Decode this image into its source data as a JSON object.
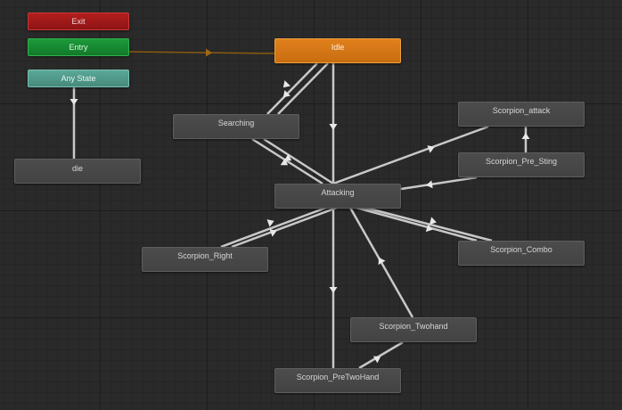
{
  "states": {
    "exit": "Exit",
    "entry": "Entry",
    "any_state": "Any State",
    "die": "die",
    "idle": "Idle",
    "searching": "Searching",
    "attacking": "Attacking",
    "scorpion_attack": "Scorpion_attack",
    "scorpion_pre_sting": "Scorpion_Pre_Sting",
    "scorpion_right": "Scorpion_Right",
    "scorpion_combo": "Scorpion_Combo",
    "scorpion_twohand": "Scorpion_Twohand",
    "scorpion_pretwohand": "Scorpion_PreTwoHand"
  },
  "colors": {
    "background": "#2a2a2a",
    "exit": "#9e1a1a",
    "entry": "#178a32",
    "any_state": "#4f9a8a",
    "default_state": "#d87a16",
    "state": "#484848",
    "transition": "#c8c8c8",
    "entry_transition": "#8a5a10"
  },
  "transitions": [
    {
      "from": "Entry",
      "to": "Idle",
      "kind": "default"
    },
    {
      "from": "Any State",
      "to": "die"
    },
    {
      "from": "Idle",
      "to": "Searching"
    },
    {
      "from": "Searching",
      "to": "Idle"
    },
    {
      "from": "Idle",
      "to": "Attacking"
    },
    {
      "from": "Searching",
      "to": "Attacking"
    },
    {
      "from": "Attacking",
      "to": "Searching"
    },
    {
      "from": "Attacking",
      "to": "Scorpion_attack"
    },
    {
      "from": "Scorpion_Pre_Sting",
      "to": "Scorpion_attack"
    },
    {
      "from": "Scorpion_Pre_Sting",
      "to": "Attacking"
    },
    {
      "from": "Attacking",
      "to": "Scorpion_Right"
    },
    {
      "from": "Scorpion_Right",
      "to": "Attacking"
    },
    {
      "from": "Attacking",
      "to": "Scorpion_Combo"
    },
    {
      "from": "Scorpion_Combo",
      "to": "Attacking"
    },
    {
      "from": "Scorpion_Twohand",
      "to": "Attacking"
    },
    {
      "from": "Attacking",
      "to": "Scorpion_PreTwoHand"
    },
    {
      "from": "Scorpion_PreTwoHand",
      "to": "Scorpion_Twohand"
    }
  ]
}
